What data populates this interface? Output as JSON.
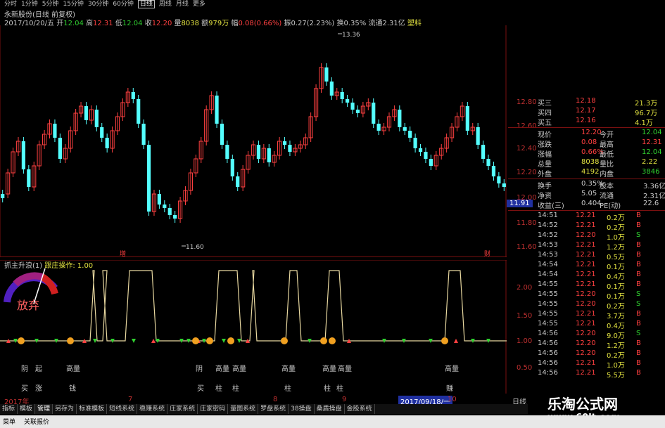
{
  "period_tabs": [
    "分时",
    "1分钟",
    "5分钟",
    "15分钟",
    "30分钟",
    "60分钟",
    "日线",
    "周线",
    "月线",
    "更多"
  ],
  "active_period": "日线",
  "stock_title": "永新股份(日线 前复权)",
  "quote": {
    "date": "2017/10/20/五",
    "open_label": "开",
    "open": "12.04",
    "high_label": "高",
    "high": "12.31",
    "low_label": "低",
    "low": "12.04",
    "close_label": "收",
    "close": "12.20",
    "vol_label": "量",
    "vol": "8038",
    "amount_label": "额",
    "amount": "979万",
    "change_label": "幅",
    "change": "0.08(0.66%)",
    "amp_label": "振",
    "amp": "0.27(2.23%)",
    "turn_label": "换",
    "turn": "0.35%",
    "float_label": "流通",
    "float": "2.31亿",
    "type_label": "塑料"
  },
  "main_chart": {
    "y_ticks": [
      "12.80",
      "12.60",
      "12.40",
      "12.20",
      "12.00",
      "11.80",
      "11.60"
    ],
    "high_marker": "13.36",
    "low_marker": "11.60",
    "current_price_tag": "11.91",
    "marker_zeng": "增",
    "marker_cai": "财"
  },
  "indicator": {
    "title": "抓主升浪(1)",
    "subtitle": "跟庄操作: 1.00",
    "gauge_label": "放弃",
    "y_ticks": [
      "2.00",
      "1.50",
      "1.00",
      "0.50"
    ],
    "annotations": [
      "阴",
      "起",
      "高量",
      "阴",
      "高量",
      "高量",
      "高量",
      "高量",
      "高量",
      "高量"
    ],
    "bottom_labels": [
      "买",
      "涨",
      "钱",
      "买",
      "柱",
      "柱",
      "柱",
      "柱",
      "柱",
      "赚"
    ]
  },
  "axis": {
    "year_label": "2017年",
    "month_7": "7",
    "month_8": "8",
    "month_9": "9",
    "month_10": "10",
    "date_cursor": "2017/09/18/一",
    "zoom_label": "日线"
  },
  "orderbook": {
    "asks": [
      {
        "label": "买三",
        "price": "12.18",
        "vol": "21.3万"
      },
      {
        "label": "买四",
        "price": "12.17",
        "vol": "96.7万"
      },
      {
        "label": "买五",
        "price": "12.16",
        "vol": "4.1万"
      }
    ],
    "stats": [
      {
        "l1": "现价",
        "v1": "12.20",
        "l2": "今开",
        "v2": "12.04"
      },
      {
        "l1": "涨跌",
        "v1": "0.08",
        "l2": "最高",
        "v2": "12.31"
      },
      {
        "l1": "涨幅",
        "v1": "0.66%",
        "l2": "最低",
        "v2": "12.04"
      },
      {
        "l1": "总量",
        "v1": "8038",
        "l2": "量比",
        "v2": "2.22"
      },
      {
        "l1": "外盘",
        "v1": "4192",
        "l2": "内盘",
        "v2": "3846"
      }
    ],
    "stats2": [
      {
        "l1": "换手",
        "v1": "0.35%",
        "l2": "股本",
        "v2": "3.36亿"
      },
      {
        "l1": "净资",
        "v1": "5.05",
        "l2": "流通",
        "v2": "2.31亿"
      },
      {
        "l1": "收益(三)",
        "v1": "0.404",
        "l2": "PE(动)",
        "v2": "22.6"
      }
    ],
    "ticks": [
      {
        "t": "14:51",
        "p": "12.21",
        "v": "0.2万",
        "s": "B"
      },
      {
        "t": "14:52",
        "p": "12.21",
        "v": "0.2万",
        "s": "B"
      },
      {
        "t": "14:52",
        "p": "12.20",
        "v": "1.0万",
        "s": "S"
      },
      {
        "t": "14:53",
        "p": "12.21",
        "v": "1.2万",
        "s": "B"
      },
      {
        "t": "14:53",
        "p": "12.21",
        "v": "0.5万",
        "s": "B"
      },
      {
        "t": "14:54",
        "p": "12.21",
        "v": "0.1万",
        "s": "B"
      },
      {
        "t": "14:54",
        "p": "12.21",
        "v": "0.4万",
        "s": "B"
      },
      {
        "t": "14:55",
        "p": "12.21",
        "v": "0.1万",
        "s": "B"
      },
      {
        "t": "14:55",
        "p": "12.20",
        "v": "0.1万",
        "s": "S"
      },
      {
        "t": "14:55",
        "p": "12.20",
        "v": "0.2万",
        "s": "S"
      },
      {
        "t": "14:55",
        "p": "12.21",
        "v": "3.7万",
        "s": "B"
      },
      {
        "t": "14:55",
        "p": "12.21",
        "v": "0.4万",
        "s": "B"
      },
      {
        "t": "14:56",
        "p": "12.20",
        "v": "9.0万",
        "s": "S"
      },
      {
        "t": "14:56",
        "p": "12.20",
        "v": "1.2万",
        "s": "B"
      },
      {
        "t": "14:56",
        "p": "12.20",
        "v": "0.2万",
        "s": "B"
      },
      {
        "t": "14:56",
        "p": "12.21",
        "v": "1.0万",
        "s": "B"
      },
      {
        "t": "14:56",
        "p": "12.21",
        "v": "5.5万",
        "s": "B"
      }
    ]
  },
  "bottom_tabs": [
    "指标",
    "模板",
    "管理",
    "另存为",
    "标准模板",
    "短线系统",
    "稳赚系统",
    "庄家系统",
    "庄家密码",
    "量图系统",
    "罗盘系统",
    "38操盘",
    "桑盾操盘",
    "金股系统"
  ],
  "active_tab": "管理",
  "watermark": {
    "cn": "乐淘公式网",
    "url": "www.60lt.com"
  },
  "status": {
    "left": "菜单",
    "sub": "关联报价"
  }
}
